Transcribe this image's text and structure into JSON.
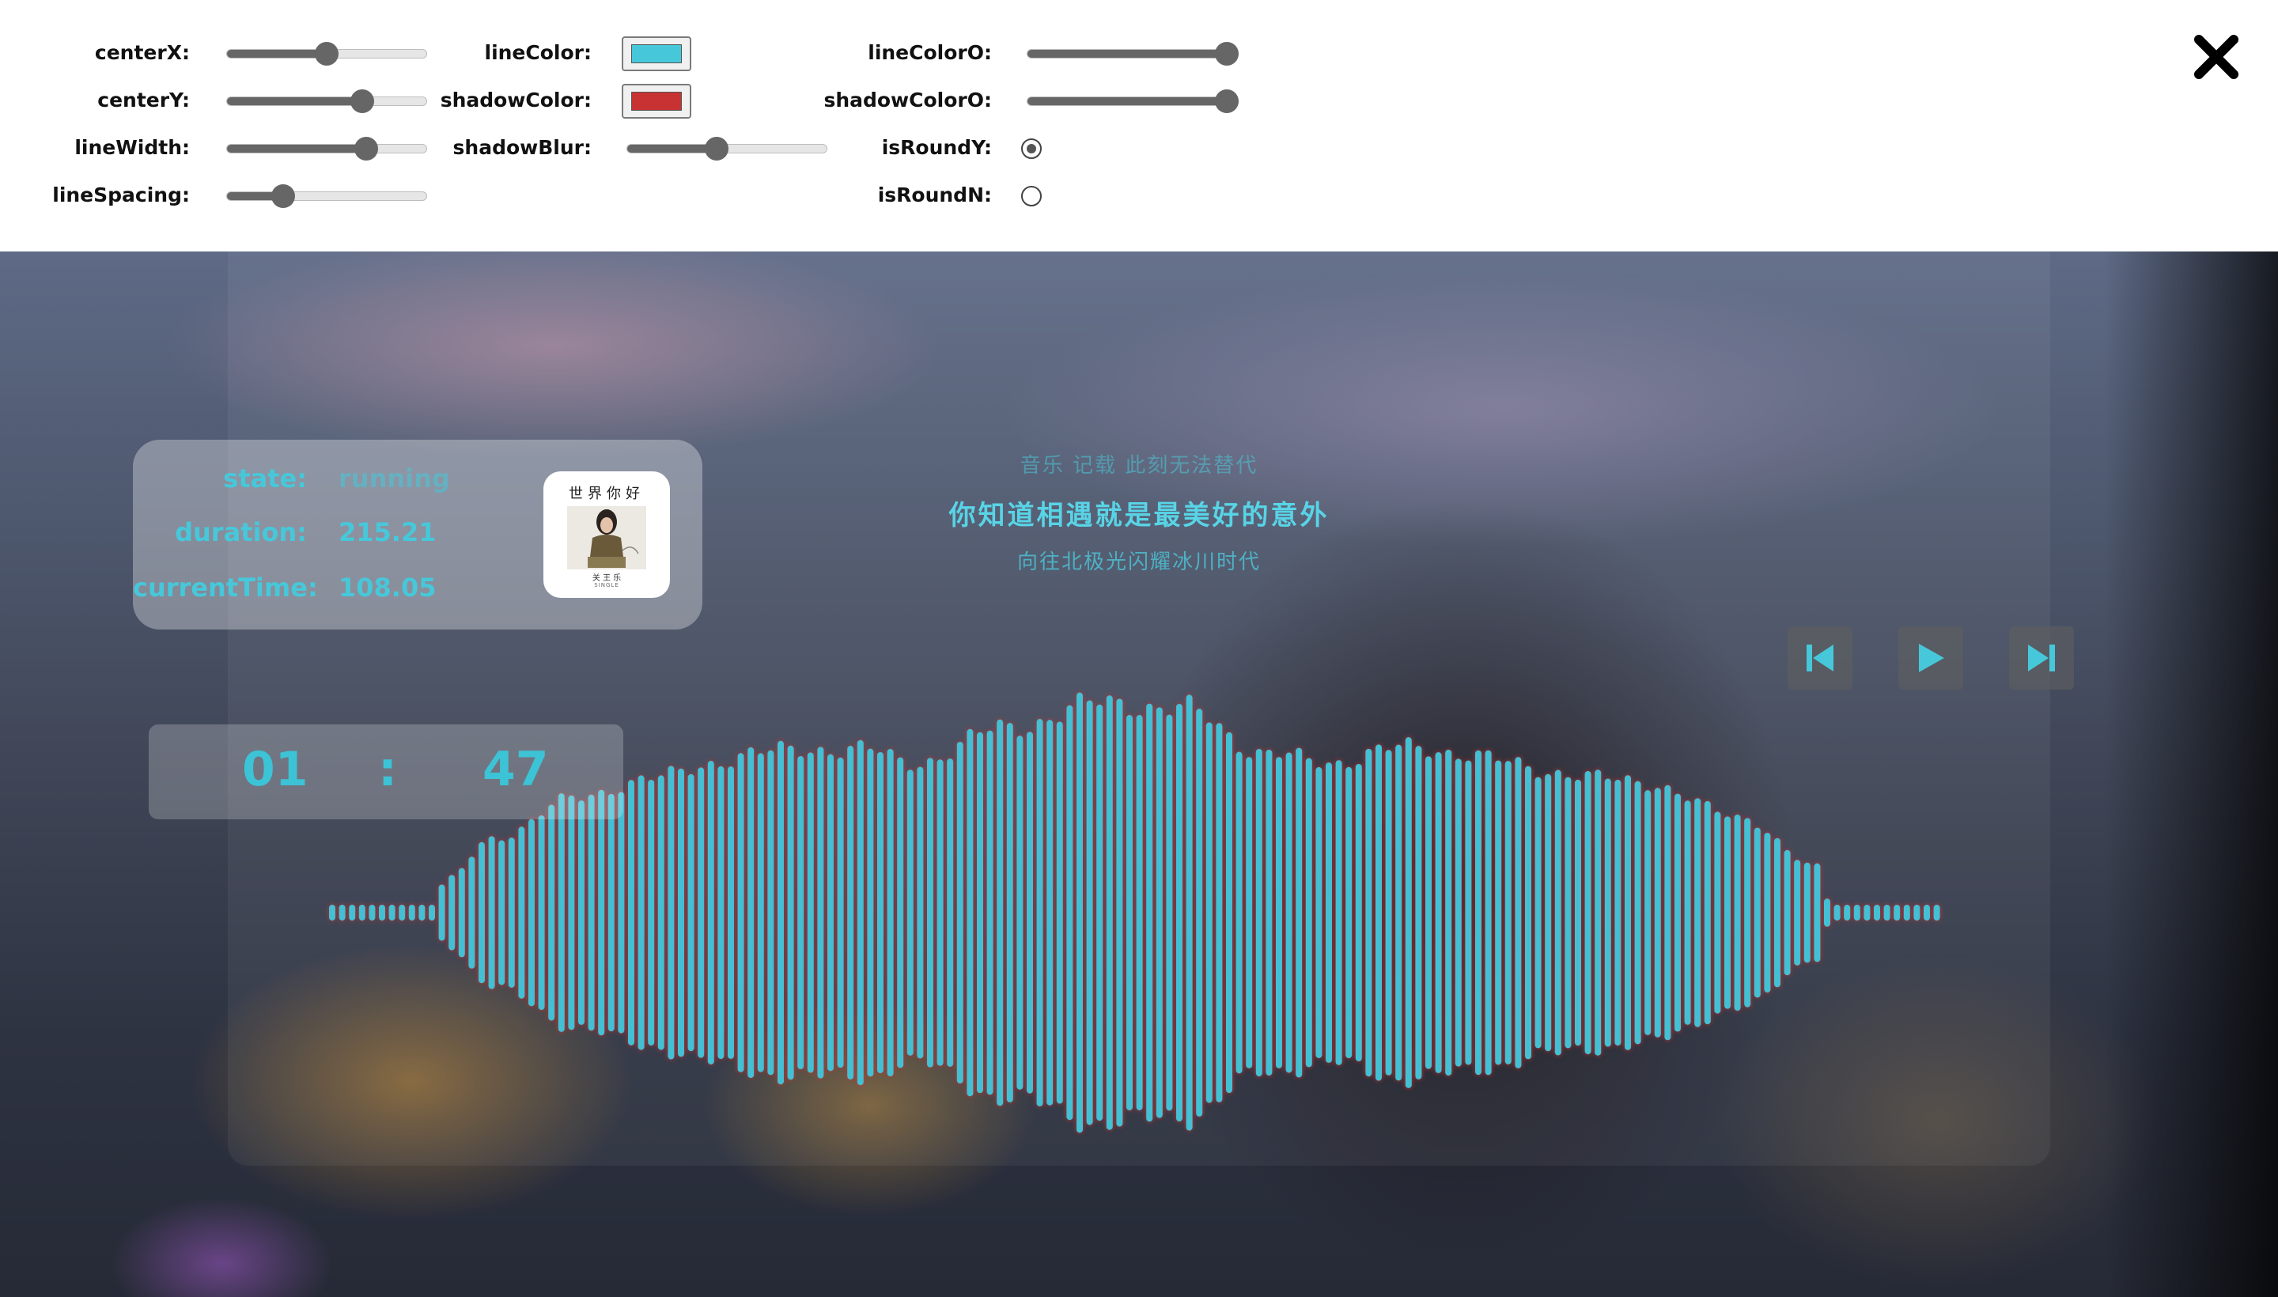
{
  "controls": {
    "centerX": {
      "label": "centerX:",
      "value": 0.5
    },
    "centerY": {
      "label": "centerY:",
      "value": 0.68
    },
    "lineWidth": {
      "label": "lineWidth:",
      "value": 0.7
    },
    "lineSpacing": {
      "label": "lineSpacing:",
      "value": 0.28
    },
    "lineColor": {
      "label": "lineColor:",
      "color": "#46c8da"
    },
    "shadowColor": {
      "label": "shadowColor:",
      "color": "#c83232"
    },
    "shadowBlur": {
      "label": "shadowBlur:",
      "value": 0.45
    },
    "lineColorO": {
      "label": "lineColorO:",
      "value": 1.0
    },
    "shadowColorO": {
      "label": "shadowColorO:",
      "value": 1.0
    },
    "isRoundY": {
      "label": "isRoundY:",
      "checked": true
    },
    "isRoundN": {
      "label": "isRoundN:",
      "checked": false
    },
    "close_icon": "close-x-icon"
  },
  "info": {
    "state_label": "state:",
    "state_value": "running",
    "duration_label": "duration:",
    "duration_value": "215.21",
    "current_label": "currentTime:",
    "current_value": "108.05",
    "album": {
      "title": "世界你好",
      "artist": "关 王 乐",
      "label_small": "SINGLE"
    }
  },
  "clock": {
    "minutes": "01",
    "separator": ":",
    "seconds": "47"
  },
  "lyrics": {
    "prev": "音乐 记载 此刻无法替代",
    "current": "你知道相遇就是最美好的意外",
    "next": "向往北极光闪耀冰川时代"
  },
  "player": {
    "prev_icon": "skip-previous-icon",
    "play_icon": "play-icon",
    "next_icon": "skip-next-icon"
  },
  "colors": {
    "accent": "#46c8da",
    "bar": "#44c0d4",
    "bar_shadow": "#c83232"
  }
}
